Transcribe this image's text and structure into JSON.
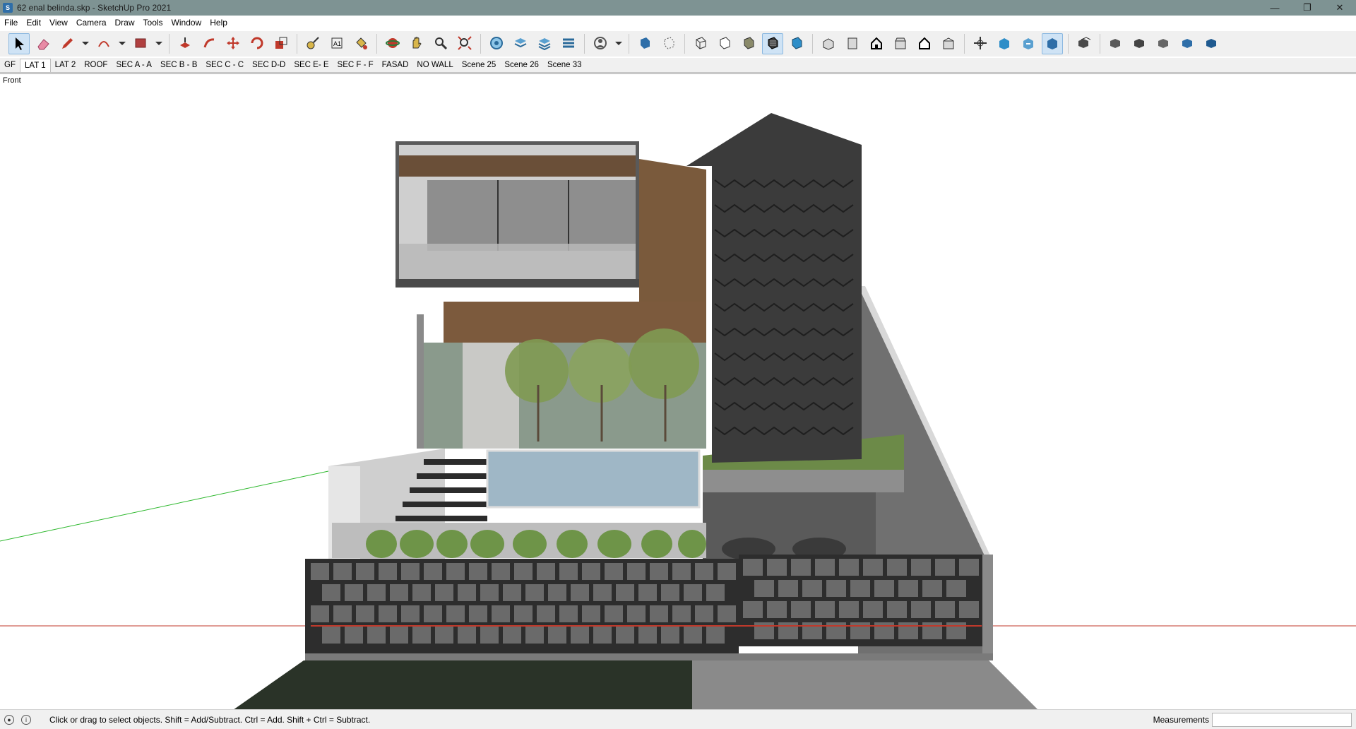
{
  "window": {
    "title": "62 enal belinda.skp - SketchUp Pro 2021",
    "min_glyph": "—",
    "max_glyph": "❐",
    "close_glyph": "✕"
  },
  "menu": [
    "File",
    "Edit",
    "View",
    "Camera",
    "Draw",
    "Tools",
    "Window",
    "Help"
  ],
  "toolbar": {
    "tools": [
      {
        "name": "select-icon",
        "active": true
      },
      {
        "name": "eraser-icon"
      },
      {
        "name": "pencil-icon"
      },
      {
        "name": "dropdown-icon"
      },
      {
        "name": "arc-icon"
      },
      {
        "name": "dropdown-icon"
      },
      {
        "name": "rectangle-icon"
      },
      {
        "name": "dropdown-icon"
      },
      {
        "sep": true
      },
      {
        "name": "push-pull-icon"
      },
      {
        "name": "follow-me-icon"
      },
      {
        "name": "move-icon"
      },
      {
        "name": "rotate-icon"
      },
      {
        "name": "scale-icon"
      },
      {
        "sep": true
      },
      {
        "name": "tape-measure-icon"
      },
      {
        "name": "text-icon"
      },
      {
        "name": "paint-bucket-icon"
      },
      {
        "sep": true
      },
      {
        "name": "orbit-icon"
      },
      {
        "name": "pan-icon"
      },
      {
        "name": "zoom-icon"
      },
      {
        "name": "zoom-extents-icon"
      },
      {
        "sep": true
      },
      {
        "name": "model-info-icon"
      },
      {
        "name": "layers-icon"
      },
      {
        "name": "tags-icon"
      },
      {
        "name": "outliner-icon"
      },
      {
        "sep": true
      },
      {
        "name": "profile-icon"
      },
      {
        "name": "dropdown-icon"
      },
      {
        "sep": true
      },
      {
        "name": "xray-icon"
      },
      {
        "name": "back-edges-icon"
      },
      {
        "sep": true
      },
      {
        "name": "wireframe-icon"
      },
      {
        "name": "hidden-line-icon"
      },
      {
        "name": "shaded-icon"
      },
      {
        "name": "shaded-textures-icon",
        "active": true
      },
      {
        "name": "monochrome-icon"
      },
      {
        "sep": true
      },
      {
        "name": "iso-view-icon"
      },
      {
        "name": "top-view-icon"
      },
      {
        "name": "front-view-icon"
      },
      {
        "name": "right-view-icon"
      },
      {
        "name": "back-view-icon"
      },
      {
        "name": "left-view-icon"
      },
      {
        "sep": true
      },
      {
        "name": "section-plane-icon"
      },
      {
        "name": "section-fill-icon"
      },
      {
        "name": "section-cuts-icon"
      },
      {
        "name": "section-display-icon",
        "active": true
      },
      {
        "sep": true
      },
      {
        "name": "component-icon"
      },
      {
        "sep": true
      },
      {
        "name": "solid-union-icon"
      },
      {
        "name": "solid-subtract-icon"
      },
      {
        "name": "solid-intersect-icon"
      },
      {
        "name": "solid-trim-icon"
      },
      {
        "name": "solid-split-icon"
      }
    ]
  },
  "scenes": {
    "tabs": [
      "GF",
      "LAT 1",
      "LAT 2",
      "ROOF",
      "SEC A - A",
      "SEC B - B",
      "SEC C - C",
      "SEC D-D",
      "SEC E- E",
      "SEC F - F",
      "FASAD",
      "NO WALL",
      "Scene 25",
      "Scene 26",
      "Scene 33"
    ],
    "active_index": 1
  },
  "viewport": {
    "view_name": "Front"
  },
  "status": {
    "hint": "Click or drag to select objects. Shift = Add/Subtract. Ctrl = Add. Shift + Ctrl = Subtract.",
    "measurements_label": "Measurements",
    "measurements_value": ""
  },
  "colors": {
    "titlebar": "#7e9393",
    "accent_active": "#cfe3f5",
    "axis_red": "#c0392b",
    "axis_green": "#2db82d"
  }
}
